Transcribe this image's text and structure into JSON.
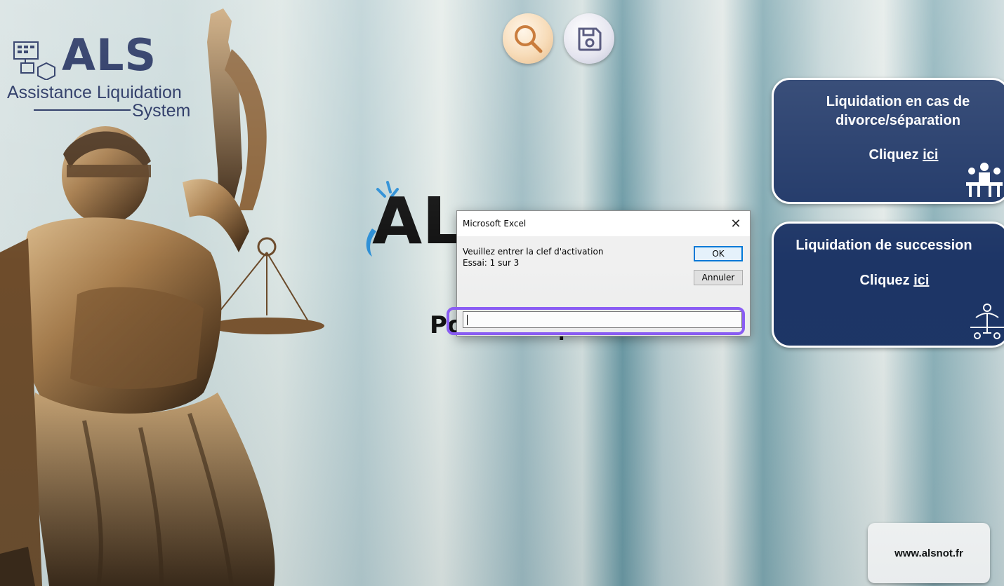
{
  "logo": {
    "name": "ALS",
    "subtitle_line1": "Assistance Liquidation",
    "subtitle_line2": "System"
  },
  "toolbar": {
    "search_icon": "magnifier-icon",
    "save_icon": "floppy-disk-icon"
  },
  "center": {
    "logo_partial": "AL",
    "tagline_partial": "Po",
    "tagline_tail": "."
  },
  "panels": [
    {
      "title": "Liquidation en cas de divorce/séparation",
      "cta_prefix": "Cliquez ",
      "cta_link": "ici",
      "icon": "meeting-people-icon"
    },
    {
      "title": "Liquidation de succession",
      "cta_prefix": "Cliquez ",
      "cta_link": "ici",
      "icon": "balance-scale-people-icon"
    }
  ],
  "website": {
    "label": "www.alsnot.fr"
  },
  "dialog": {
    "title": "Microsoft Excel",
    "close": "✕",
    "message": "Veuillez entrer la clef d'activation",
    "attempt": "Essai: 1 sur 3",
    "ok_label": "OK",
    "cancel_label": "Annuler",
    "input_value": ""
  },
  "colors": {
    "panel_bg": "#1d3566",
    "brand_navy": "#1b2a5a",
    "highlight": "#8b5cf6",
    "ok_border": "#0078d7"
  }
}
